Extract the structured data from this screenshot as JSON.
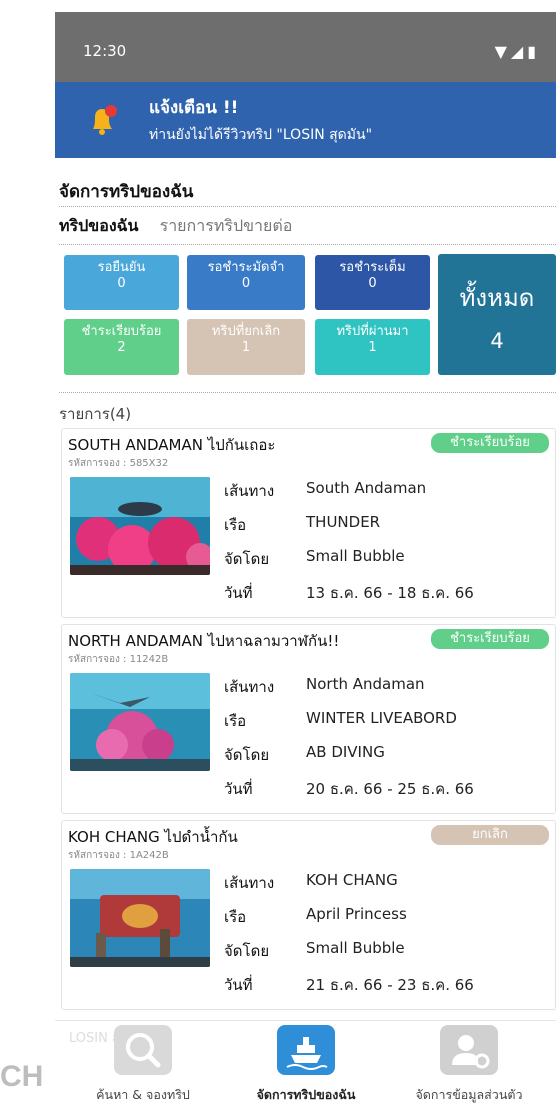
{
  "status_bar": {
    "time": "12:30",
    "icons": "▼◢▮"
  },
  "notification": {
    "title": "แจ้งเตือน !!",
    "message": "ท่านยังไม่ได้รีวิวทริป \"LOSIN สุดมัน\""
  },
  "page": {
    "title": "จัดการทริปของฉัน",
    "tabs": [
      "ทริปของฉัน",
      "รายการทริปขายต่อ"
    ]
  },
  "status_tiles": [
    {
      "label": "รอยืนยัน",
      "count": "0"
    },
    {
      "label": "รอชำระมัดจำ",
      "count": "0"
    },
    {
      "label": "รอชำระเต็ม",
      "count": "0"
    },
    {
      "label": "ชำระเรียบร้อย",
      "count": "2"
    },
    {
      "label": "ทริปที่ยกเลิก",
      "count": "1"
    },
    {
      "label": "ทริปที่ผ่านมา",
      "count": "1"
    }
  ],
  "total_tile": {
    "label": "ทั้งหมด",
    "count": "4"
  },
  "list_header": "รายการ(4)",
  "field_labels": {
    "route": "เส้นทาง",
    "boat": "เรือ",
    "organizer": "จัดโดย",
    "date": "วันที่"
  },
  "trips": [
    {
      "name": "SOUTH ANDAMAN ไปกันเถอะ",
      "code": "รหัสการจอง : 585X32",
      "status": "ชำระเรียบร้อย",
      "route": "South Andaman",
      "boat": "THUNDER",
      "organizer": "Small Bubble",
      "date": "13 ธ.ค. 66 - 18 ธ.ค. 66"
    },
    {
      "name": "NORTH ANDAMAN ไปหาฉลามวาฬกัน!!",
      "code": "รหัสการจอง : 11242B",
      "status": "ชำระเรียบร้อย",
      "route": "North Andaman",
      "boat": "WINTER LIVEABORD",
      "organizer": "AB DIVING",
      "date": "20 ธ.ค. 66 - 25 ธ.ค. 66"
    },
    {
      "name": "KOH CHANG ไปดำน้ำกัน",
      "code": "รหัสการจอง : 1A242B",
      "status": "ยกเลิก",
      "route": "KOH CHANG",
      "boat": "April Princess",
      "organizer": "Small Bubble",
      "date": "21 ธ.ค. 66 - 23 ธ.ค. 66"
    }
  ],
  "partial_trip_name": "LOSIN สุดมัน",
  "bottom_nav": [
    {
      "label": "ค้นหา & จองทริป",
      "icon": "search-icon"
    },
    {
      "label": "จัดการทริปของฉัน",
      "icon": "ship-icon"
    },
    {
      "label": "จัดการข้อมูลส่วนตัว",
      "icon": "user-settings-icon"
    }
  ],
  "edge_logo": "CH",
  "colors": {
    "notification_bg": "#2f63ad",
    "paid": "#5fcf8a",
    "cancel": "#d5c3b3",
    "total": "#227497",
    "nav_active": "#2f8ed8"
  }
}
